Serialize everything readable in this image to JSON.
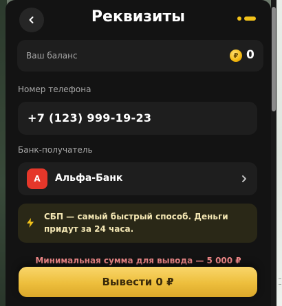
{
  "header": {
    "title": "Реквизиты",
    "back_icon": "chevron-left-icon"
  },
  "balance": {
    "label": "Ваш баланс",
    "coin_symbol": "₽",
    "value": "0"
  },
  "phone": {
    "label": "Номер телефона",
    "value": "+7 (123) 999-19-23"
  },
  "bank": {
    "label": "Банк-получатель",
    "logo_letter": "А",
    "name": "Альфа-Банк",
    "logo_color": "#e5372a"
  },
  "info": {
    "text": "СБП — самый быстрый способ. Деньги придут за 24 часа.",
    "icon": "bolt-icon"
  },
  "min_amount": "Минимальная сумма для вывода — 5 000 ₽",
  "withdraw_button": "Вывести 0 ₽",
  "colors": {
    "accent": "#f2c21a",
    "panel": "#131313",
    "card": "#1e1e1e",
    "warning_text": "#f28a8a"
  }
}
